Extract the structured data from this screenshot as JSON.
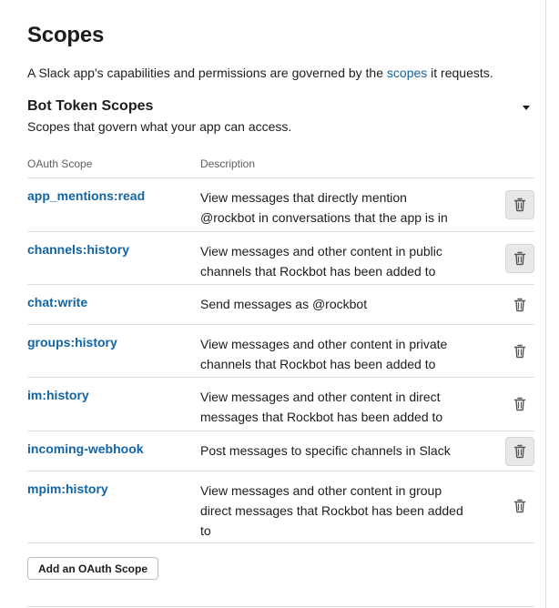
{
  "page": {
    "title": "Scopes",
    "intro_before": "A Slack app's capabilities and permissions are governed by the ",
    "intro_link": "scopes",
    "intro_after": " it requests."
  },
  "section": {
    "title": "Bot Token Scopes",
    "subtitle": "Scopes that govern what your app can access.",
    "toggle_icon": "caret-down-icon"
  },
  "table": {
    "headers": {
      "scope": "OAuth Scope",
      "description": "Description"
    },
    "rows": [
      {
        "scope": "app_mentions:read",
        "description": "View messages that directly mention @rockbot in conversations that the app is in",
        "remove_highlighted": true
      },
      {
        "scope": "channels:history",
        "description": "View messages and other content in public channels that Rockbot has been added to",
        "remove_highlighted": true
      },
      {
        "scope": "chat:write",
        "description": "Send messages as @rockbot",
        "remove_highlighted": false
      },
      {
        "scope": "groups:history",
        "description": "View messages and other content in private channels that Rockbot has been added to",
        "remove_highlighted": false
      },
      {
        "scope": "im:history",
        "description": "View messages and other content in direct messages that Rockbot has been added to",
        "remove_highlighted": false
      },
      {
        "scope": "incoming-webhook",
        "description": "Post messages to specific channels in Slack",
        "remove_highlighted": true
      },
      {
        "scope": "mpim:history",
        "description": "View messages and other content in group direct messages that Rockbot has been added to",
        "remove_highlighted": false
      }
    ],
    "remove_icon": "trash-icon"
  },
  "actions": {
    "add_scope_label": "Add an OAuth Scope"
  },
  "colors": {
    "link": "#1264a3",
    "text": "#1d1c1d",
    "muted": "#616061",
    "divider": "#dddddd",
    "button_hover_bg": "#e8e8e8"
  }
}
